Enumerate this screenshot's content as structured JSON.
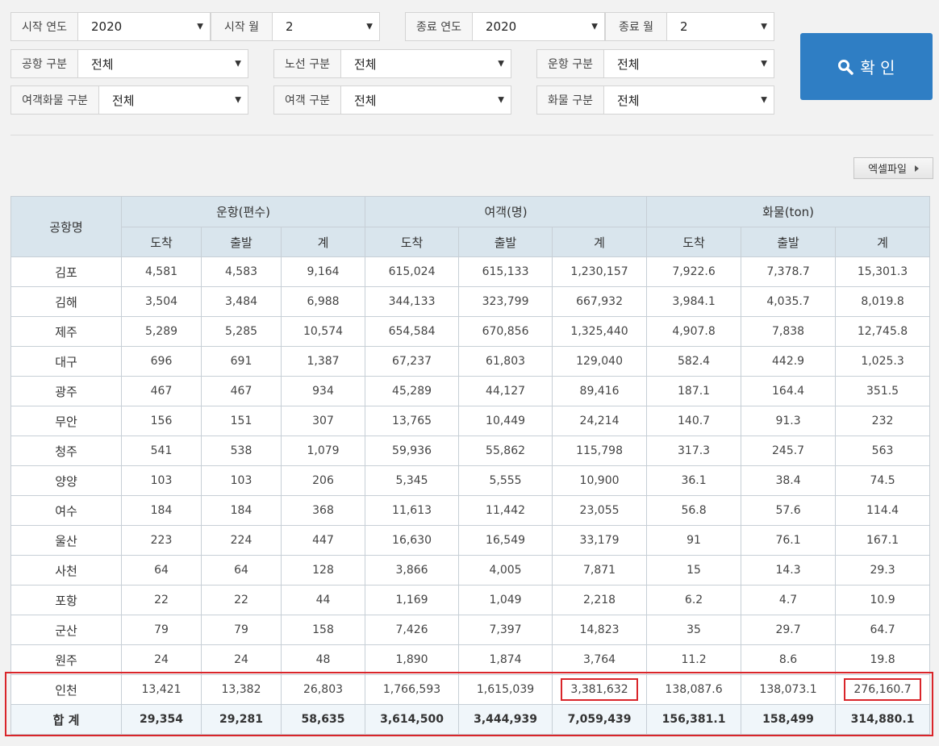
{
  "filters": {
    "start_year": {
      "label": "시작 연도",
      "value": "2020"
    },
    "start_month": {
      "label": "시작 월",
      "value": "2"
    },
    "end_year": {
      "label": "종료 연도",
      "value": "2020"
    },
    "end_month": {
      "label": "종료 월",
      "value": "2"
    },
    "airport_type": {
      "label": "공항 구분",
      "value": "전체"
    },
    "route_type": {
      "label": "노선 구분",
      "value": "전체"
    },
    "flight_type": {
      "label": "운항 구분",
      "value": "전체"
    },
    "pax_cargo_type": {
      "label": "여객화물 구분",
      "value": "전체"
    },
    "pax_type": {
      "label": "여객 구분",
      "value": "전체"
    },
    "cargo_type": {
      "label": "화물 구분",
      "value": "전체"
    }
  },
  "confirm_label": "확 인",
  "excel_label": "엑셀파일",
  "table": {
    "airport_header": "공항명",
    "groups": [
      "운항(편수)",
      "여객(명)",
      "화물(ton)"
    ],
    "sub_headers": [
      "도착",
      "출발",
      "계",
      "도착",
      "출발",
      "계",
      "도착",
      "출발",
      "계"
    ],
    "rows": [
      {
        "name": "김포",
        "cells": [
          "4,581",
          "4,583",
          "9,164",
          "615,024",
          "615,133",
          "1,230,157",
          "7,922.6",
          "7,378.7",
          "15,301.3"
        ]
      },
      {
        "name": "김해",
        "cells": [
          "3,504",
          "3,484",
          "6,988",
          "344,133",
          "323,799",
          "667,932",
          "3,984.1",
          "4,035.7",
          "8,019.8"
        ]
      },
      {
        "name": "제주",
        "cells": [
          "5,289",
          "5,285",
          "10,574",
          "654,584",
          "670,856",
          "1,325,440",
          "4,907.8",
          "7,838",
          "12,745.8"
        ]
      },
      {
        "name": "대구",
        "cells": [
          "696",
          "691",
          "1,387",
          "67,237",
          "61,803",
          "129,040",
          "582.4",
          "442.9",
          "1,025.3"
        ]
      },
      {
        "name": "광주",
        "cells": [
          "467",
          "467",
          "934",
          "45,289",
          "44,127",
          "89,416",
          "187.1",
          "164.4",
          "351.5"
        ]
      },
      {
        "name": "무안",
        "cells": [
          "156",
          "151",
          "307",
          "13,765",
          "10,449",
          "24,214",
          "140.7",
          "91.3",
          "232"
        ]
      },
      {
        "name": "청주",
        "cells": [
          "541",
          "538",
          "1,079",
          "59,936",
          "55,862",
          "115,798",
          "317.3",
          "245.7",
          "563"
        ]
      },
      {
        "name": "양양",
        "cells": [
          "103",
          "103",
          "206",
          "5,345",
          "5,555",
          "10,900",
          "36.1",
          "38.4",
          "74.5"
        ]
      },
      {
        "name": "여수",
        "cells": [
          "184",
          "184",
          "368",
          "11,613",
          "11,442",
          "23,055",
          "56.8",
          "57.6",
          "114.4"
        ]
      },
      {
        "name": "울산",
        "cells": [
          "223",
          "224",
          "447",
          "16,630",
          "16,549",
          "33,179",
          "91",
          "76.1",
          "167.1"
        ]
      },
      {
        "name": "사천",
        "cells": [
          "64",
          "64",
          "128",
          "3,866",
          "4,005",
          "7,871",
          "15",
          "14.3",
          "29.3"
        ]
      },
      {
        "name": "포항",
        "cells": [
          "22",
          "22",
          "44",
          "1,169",
          "1,049",
          "2,218",
          "6.2",
          "4.7",
          "10.9"
        ]
      },
      {
        "name": "군산",
        "cells": [
          "79",
          "79",
          "158",
          "7,426",
          "7,397",
          "14,823",
          "35",
          "29.7",
          "64.7"
        ]
      },
      {
        "name": "원주",
        "cells": [
          "24",
          "24",
          "48",
          "1,890",
          "1,874",
          "3,764",
          "11.2",
          "8.6",
          "19.8"
        ]
      },
      {
        "name": "인천",
        "cells": [
          "13,421",
          "13,382",
          "26,803",
          "1,766,593",
          "1,615,039",
          "3,381,632",
          "138,087.6",
          "138,073.1",
          "276,160.7"
        ]
      }
    ],
    "total": {
      "name": "합 계",
      "cells": [
        "29,354",
        "29,281",
        "58,635",
        "3,614,500",
        "3,444,939",
        "7,059,439",
        "156,381.1",
        "158,499",
        "314,880.1"
      ]
    }
  }
}
